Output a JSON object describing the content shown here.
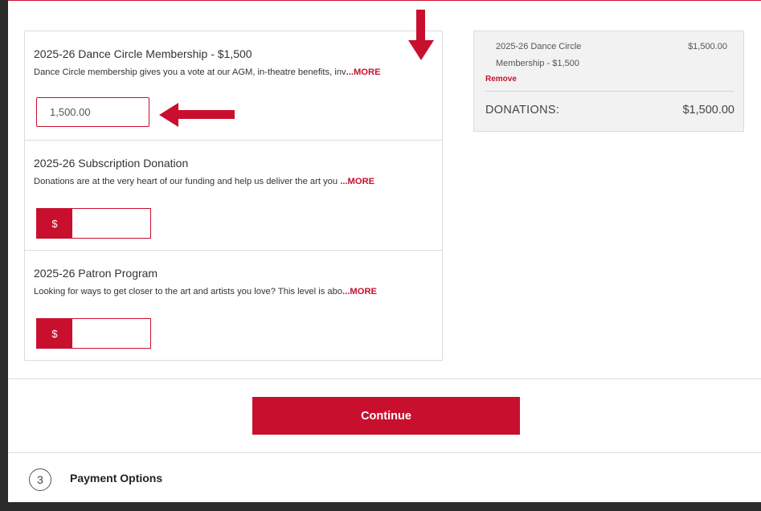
{
  "donations": [
    {
      "title": "2025-26 Dance Circle Membership - $1,500",
      "description": "Dance Circle membership gives you a vote at our AGM, in-theatre benefits, inv",
      "more_label": "...MORE",
      "amount_value": "1,500.00"
    },
    {
      "title": "2025-26 Subscription Donation",
      "description": "Donations are at the very heart of our funding and help us deliver the art you ",
      "more_label": "...MORE",
      "currency_symbol": "$",
      "amount_value": ""
    },
    {
      "title": "2025-26 Patron Program",
      "description": "Looking for ways to get closer to the art and artists you love? This level is abo",
      "more_label": "...MORE",
      "currency_symbol": "$",
      "amount_value": ""
    }
  ],
  "summary": {
    "item_name": "2025-26 Dance Circle Membership - $1,500",
    "item_price": "$1,500.00",
    "remove_label": "Remove",
    "total_label": "DONATIONS:",
    "total_value": "$1,500.00"
  },
  "continue_label": "Continue",
  "next_step": {
    "number": "3",
    "label": "Payment Options"
  },
  "colors": {
    "accent": "#c8102e",
    "frame": "#2b2b2b",
    "summary_bg": "#f2f2f2"
  },
  "icons": [
    "arrow-down-icon",
    "arrow-left-icon"
  ]
}
